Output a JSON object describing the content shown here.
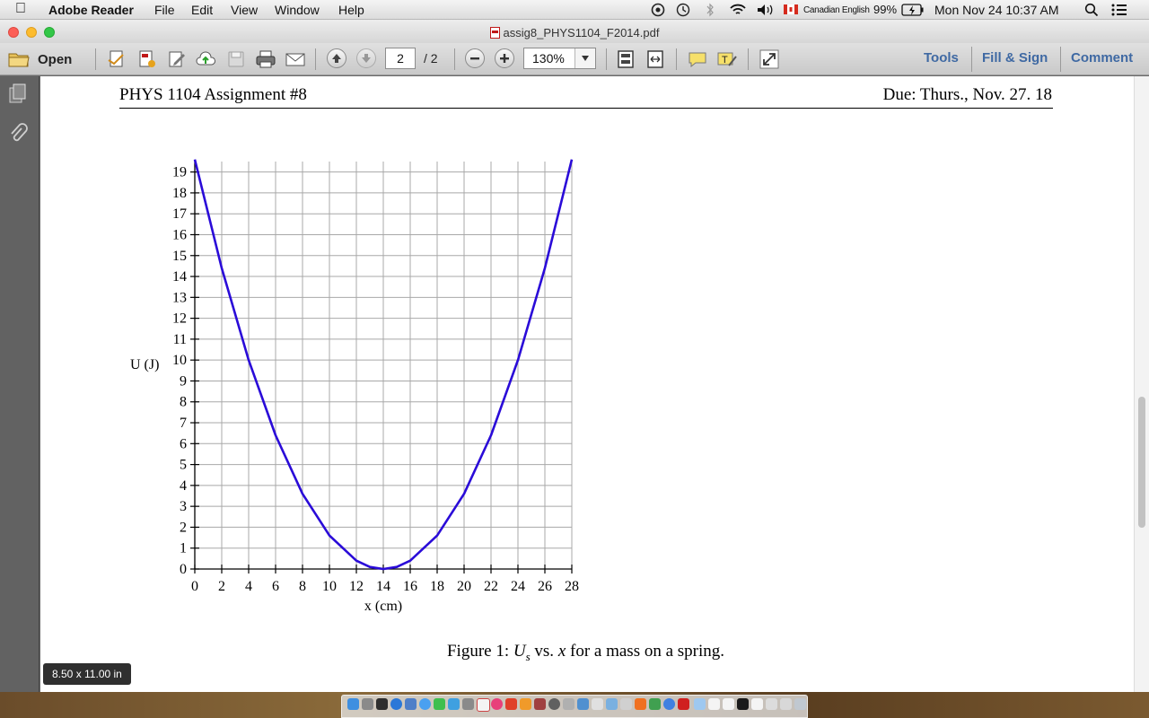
{
  "menubar": {
    "app_name": "Adobe Reader",
    "menus": [
      "File",
      "Edit",
      "View",
      "Window",
      "Help"
    ],
    "input_source": "Canadian English",
    "battery": "99%",
    "clock": "Mon Nov 24  10:37 AM"
  },
  "window": {
    "title": "assig8_PHYS1104_F2014.pdf"
  },
  "toolbar": {
    "open_label": "Open",
    "page_current": "2",
    "page_total": "/ 2",
    "zoom": "130%",
    "tools_label": "Tools",
    "fill_sign_label": "Fill & Sign",
    "comment_label": "Comment"
  },
  "document": {
    "header_left": "PHYS 1104 Assignment #8",
    "header_right": "Due: Thurs., Nov. 27. 18",
    "caption_prefix": "Figure 1: ",
    "caption_U": "U",
    "caption_sub": "s",
    "caption_mid": " vs. ",
    "caption_x": "x",
    "caption_suffix": " for a mass on a spring.",
    "page_size": "8.50 x 11.00 in"
  },
  "colors": {
    "curve": "#2a0bd8",
    "link": "#3f69a3"
  },
  "chart_data": {
    "type": "line",
    "xlabel": "x (cm)",
    "ylabel": "U (J)",
    "xlim": [
      0,
      28
    ],
    "ylim": [
      0,
      19.5
    ],
    "x_ticks": [
      0,
      2,
      4,
      6,
      8,
      10,
      12,
      14,
      16,
      18,
      20,
      22,
      24,
      26,
      28
    ],
    "y_ticks": [
      0,
      1,
      2,
      3,
      4,
      5,
      6,
      7,
      8,
      9,
      10,
      11,
      12,
      13,
      14,
      15,
      16,
      17,
      18,
      19
    ],
    "grid": true,
    "series": [
      {
        "x": [
          0,
          2,
          4,
          6,
          8,
          10,
          12,
          13,
          14,
          15,
          16,
          18,
          20,
          22,
          24,
          26,
          28
        ],
        "y": [
          19.6,
          14.4,
          10.0,
          6.4,
          3.6,
          1.6,
          0.4,
          0.1,
          0,
          0.1,
          0.4,
          1.6,
          3.6,
          6.4,
          10.0,
          14.4,
          19.6
        ]
      }
    ]
  }
}
